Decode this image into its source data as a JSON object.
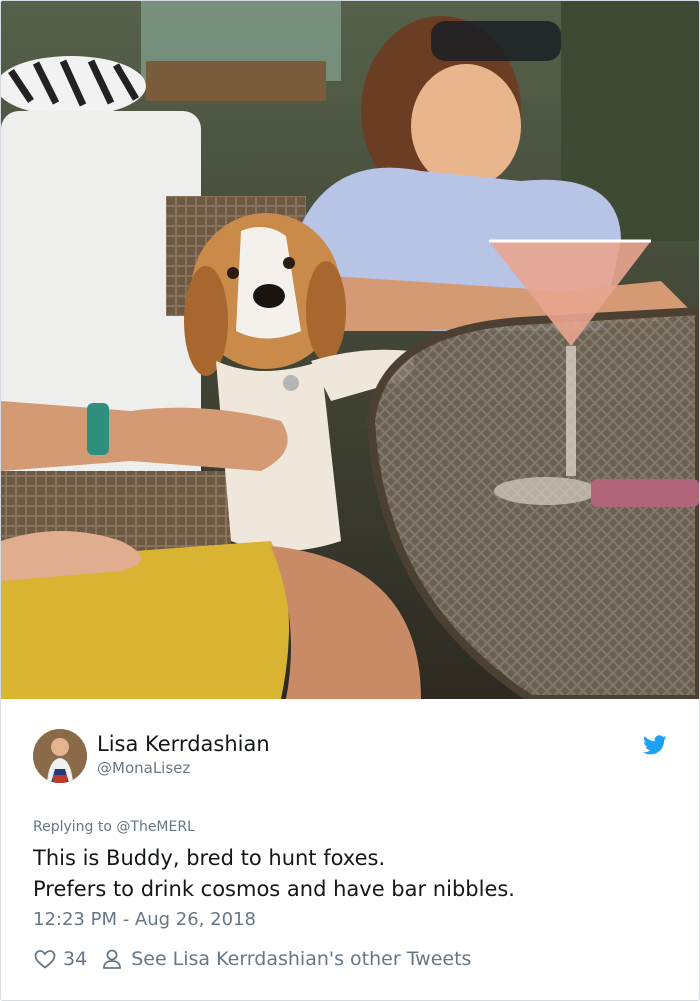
{
  "tweet": {
    "author_name": "Lisa Kerrdashian",
    "author_handle": "@MonaLisez",
    "replying_prefix": "Replying to",
    "replying_to": "@TheMERL",
    "text_lines": [
      "This is Buddy, bred to hunt foxes.",
      "Prefers to drink cosmos and have bar nibbles."
    ],
    "timestamp": "12:23 PM - Aug 26, 2018",
    "likes": "34",
    "other_tweets_link": "See Lisa Kerrdashian's other Tweets"
  },
  "icons": {
    "brand": "twitter-bird-icon",
    "like": "heart-icon",
    "profile": "person-icon"
  },
  "colors": {
    "twitter_blue": "#1da1f2",
    "text_primary": "#14171a",
    "text_secondary": "#657786",
    "border": "#d5dbe0"
  }
}
